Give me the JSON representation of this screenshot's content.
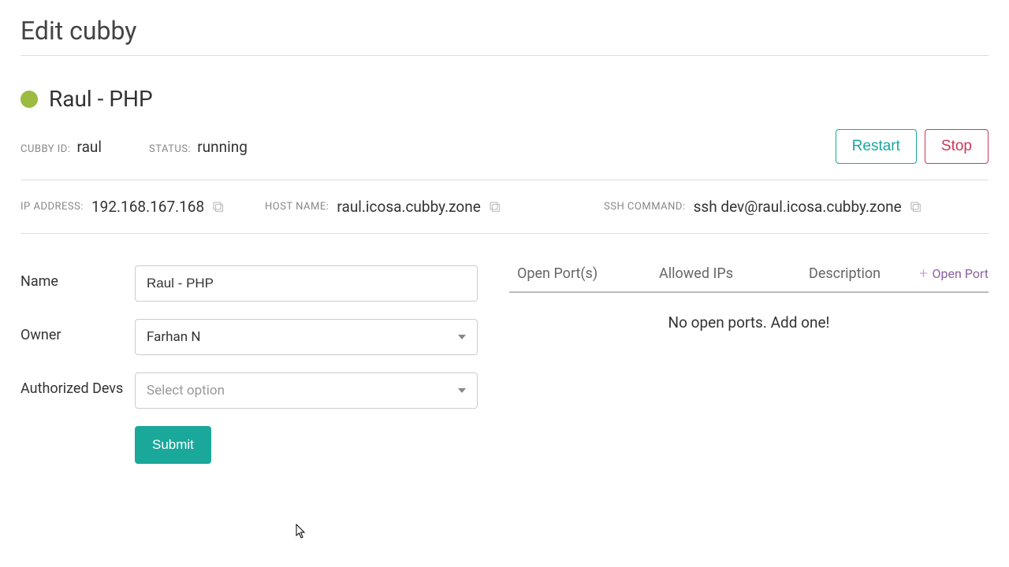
{
  "page_title": "Edit cubby",
  "cubby": {
    "display_name": "Raul - PHP",
    "status_color": "#9bbb41"
  },
  "meta": {
    "id_label": "CUBBY ID:",
    "id_value": "raul",
    "status_label": "STATUS:",
    "status_value": "running"
  },
  "actions": {
    "restart": "Restart",
    "stop": "Stop"
  },
  "net": {
    "ip_label": "IP ADDRESS:",
    "ip_value": "192.168.167.168",
    "host_label": "HOST NAME:",
    "host_value": "raul.icosa.cubby.zone",
    "ssh_label": "SSH COMMAND:",
    "ssh_value": "ssh dev@raul.icosa.cubby.zone"
  },
  "form": {
    "name_label": "Name",
    "name_value": "Raul - PHP",
    "owner_label": "Owner",
    "owner_value": "Farhan N",
    "devs_label": "Authorized Devs",
    "devs_placeholder": "Select option",
    "submit": "Submit"
  },
  "ports": {
    "col_ports": "Open Port(s)",
    "col_ips": "Allowed IPs",
    "col_desc": "Description",
    "open_port": "Open Port",
    "empty": "No open ports. Add one!"
  }
}
